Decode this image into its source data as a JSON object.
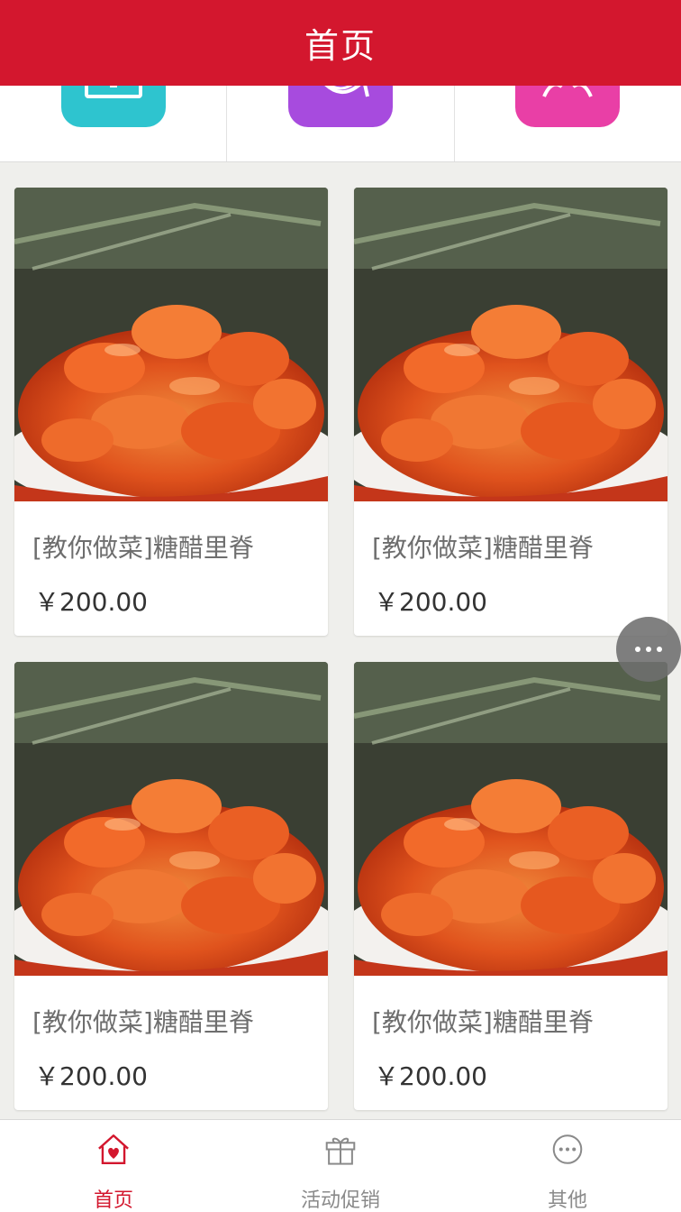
{
  "header": {
    "title": "首页"
  },
  "categories": [
    {
      "icon": "tablet-icon",
      "color": "#2ec4cf"
    },
    {
      "icon": "chat-icon",
      "color": "#a74bde"
    },
    {
      "icon": "people-icon",
      "color": "#e93fa6"
    }
  ],
  "products": [
    {
      "title": "[教你做菜]糖醋里脊",
      "price": "￥200.00"
    },
    {
      "title": "[教你做菜]糖醋里脊",
      "price": "￥200.00"
    },
    {
      "title": "[教你做菜]糖醋里脊",
      "price": "￥200.00"
    },
    {
      "title": "[教你做菜]糖醋里脊",
      "price": "￥200.00"
    }
  ],
  "tabbar": {
    "items": [
      {
        "label": "首页",
        "icon": "home-heart-icon",
        "active": true
      },
      {
        "label": "活动促销",
        "icon": "gift-icon",
        "active": false
      },
      {
        "label": "其他",
        "icon": "more-circle-icon",
        "active": false
      }
    ]
  },
  "colors": {
    "brand": "#d3172e",
    "background": "#efefec",
    "price": "#333333",
    "title": "#6e6e6e"
  }
}
